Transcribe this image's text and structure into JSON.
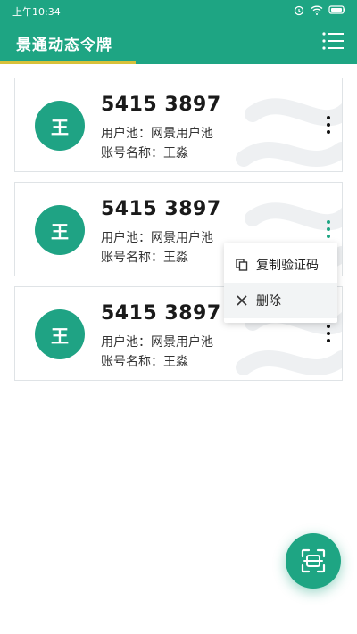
{
  "status": {
    "time": "上午10:34"
  },
  "header": {
    "title": "景通动态令牌"
  },
  "accounts": [
    {
      "avatar": "王",
      "code": "5415 3897",
      "pool": "用户池：网景用户池",
      "name": "账号名称：王淼"
    },
    {
      "avatar": "王",
      "code": "5415 3897",
      "pool": "用户池：网景用户池",
      "name": "账号名称：王淼"
    },
    {
      "avatar": "王",
      "code": "5415 3897",
      "pool": "用户池：网景用户池",
      "name": "账号名称：王淼"
    }
  ],
  "menu": {
    "copy_label": "复制验证码",
    "delete_label": "删除"
  },
  "colors": {
    "primary": "#1ea583",
    "accent_bar": "#d8c13a"
  },
  "icons": {
    "menu": "list-menu-icon",
    "more": "more-vert-icon",
    "copy": "copy-icon",
    "delete": "close-icon",
    "scan": "scan-icon"
  }
}
